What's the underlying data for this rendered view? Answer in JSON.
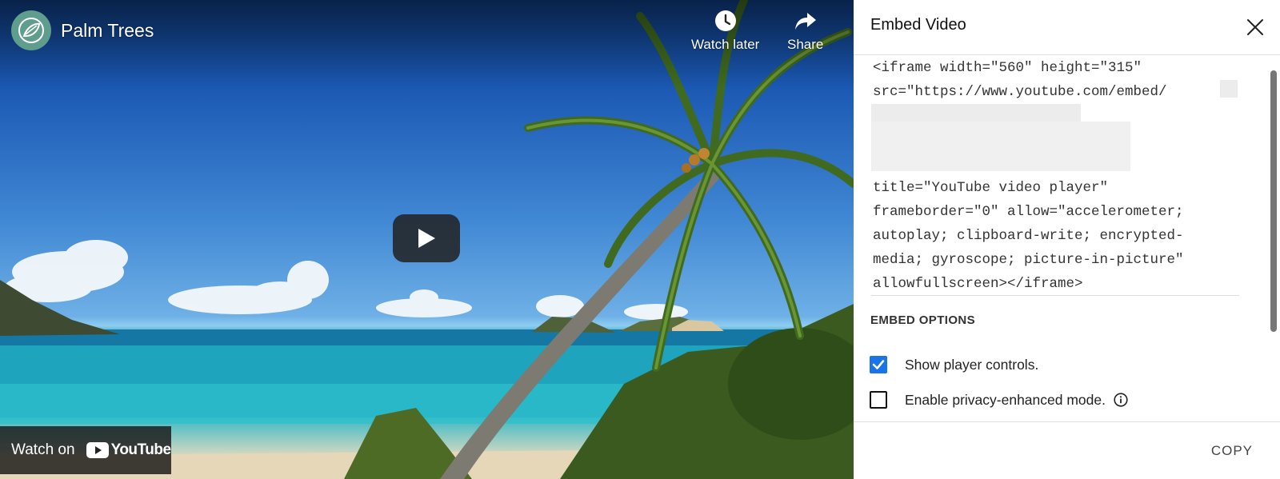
{
  "video": {
    "title": "Palm Trees",
    "actions": {
      "watch_later": "Watch later",
      "share": "Share"
    },
    "watch_on": {
      "label": "Watch on",
      "brand": "YouTube"
    }
  },
  "embed_panel": {
    "title": "Embed Video",
    "code_lines": [
      "<iframe width=\"560\" height=\"315\"",
      "src=\"https://www.youtube.com/embed/",
      "",
      "",
      "",
      "title=\"YouTube video player\"",
      "frameborder=\"0\" allow=\"accelerometer;",
      "autoplay; clipboard-write; encrypted-",
      "media; gyroscope; picture-in-picture\"",
      "allowfullscreen></iframe>"
    ],
    "options_title": "EMBED OPTIONS",
    "options": [
      {
        "label": "Show player controls.",
        "checked": true
      },
      {
        "label": "Enable privacy-enhanced mode.",
        "checked": false
      }
    ],
    "copy_label": "COPY"
  },
  "colors": {
    "checkbox_accent": "#1a73e8",
    "avatar_bg": "#5f9d8c",
    "youtube_red": "#ffffff"
  }
}
